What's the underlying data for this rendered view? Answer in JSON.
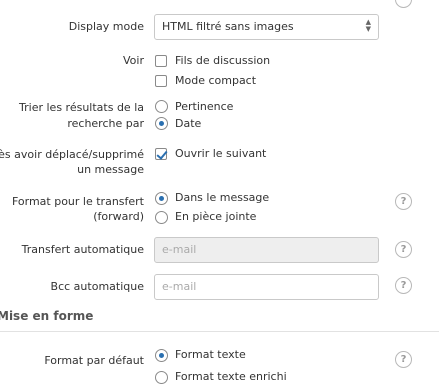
{
  "display_mode": {
    "label": "Display mode",
    "value": "HTML filtré sans images"
  },
  "voir": {
    "label": "Voir",
    "options": [
      {
        "label": "Fils de discussion",
        "checked": false
      },
      {
        "label": "Mode compact",
        "checked": false
      }
    ]
  },
  "sort": {
    "label_line1": "Trier les résultats de la",
    "label_line2": "recherche par",
    "options": [
      {
        "label": "Pertinence",
        "selected": false
      },
      {
        "label": "Date",
        "selected": true
      }
    ]
  },
  "after_move": {
    "label_line1": "Après avoir déplacé/supprimé",
    "label_line2": "un message",
    "option": {
      "label": "Ouvrir le suivant",
      "checked": true
    }
  },
  "forward_format": {
    "label_line1": "Format pour le transfert",
    "label_line2": "(forward)",
    "options": [
      {
        "label": "Dans le message",
        "selected": true
      },
      {
        "label": "En pièce jointe",
        "selected": false
      }
    ]
  },
  "auto_forward": {
    "label": "Transfert automatique",
    "placeholder": "e-mail"
  },
  "auto_bcc": {
    "label": "Bcc automatique",
    "placeholder": "e-mail"
  },
  "section": {
    "title": "Mise en forme"
  },
  "default_format": {
    "label": "Format par défaut",
    "options": [
      {
        "label": "Format texte",
        "selected": true
      },
      {
        "label": "Format texte enrichi",
        "selected": false
      }
    ]
  },
  "help_glyph": "?",
  "colors": {
    "accent": "#2a6fb0",
    "border": "#c9c9c9",
    "disabled_bg": "#eeeeee"
  }
}
